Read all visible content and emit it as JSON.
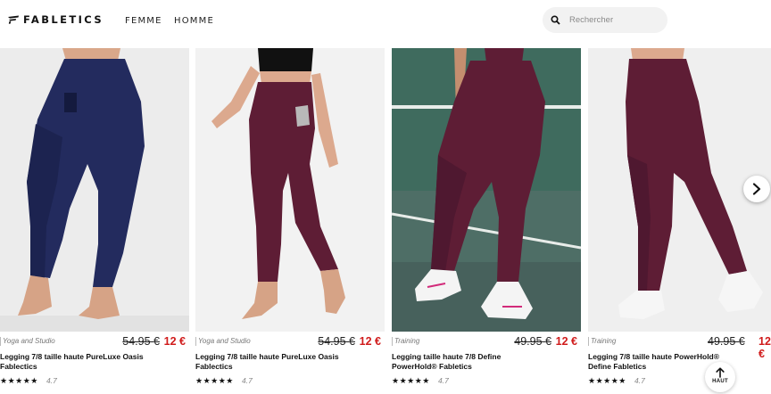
{
  "header": {
    "brand": "FABLETICS",
    "nav": {
      "femme": "FEMME",
      "homme": "HOMME"
    },
    "search_placeholder": "Rechercher"
  },
  "products": [
    {
      "category": "Yoga and Studio",
      "old_price": "54.95 €",
      "new_price": "12 €",
      "name": "Legging 7/8 taille haute PureLuxe Oasis Fablectics",
      "stars": "★★★★★",
      "rating": "4.7",
      "color": "navy"
    },
    {
      "category": "Yoga and Studio",
      "old_price": "54.95 €",
      "new_price": "12 €",
      "name": "Legging 7/8 taille haute PureLuxe Oasis Fablectics",
      "stars": "★★★★★",
      "rating": "4.7",
      "color": "plum"
    },
    {
      "category": "Training",
      "old_price": "49.95 €",
      "new_price": "12 €",
      "name": "Legging taille haute 7/8 Define PowerHold® Fabletics",
      "stars": "★★★★★",
      "rating": "4.7",
      "color": "plum"
    },
    {
      "category": "Training",
      "old_price": "49.95 €",
      "new_price": "12 €",
      "name": "Legging 7/8 taille haute PowerHold® Define Fabletics",
      "stars": "★★★★★",
      "rating": "4.7",
      "color": "plum"
    }
  ],
  "back_to_top_label": "HAUT",
  "colors": {
    "sale": "#d01b1b",
    "navy": "#232b5e",
    "plum": "#5e1d35",
    "court": "#3f6b5e"
  }
}
